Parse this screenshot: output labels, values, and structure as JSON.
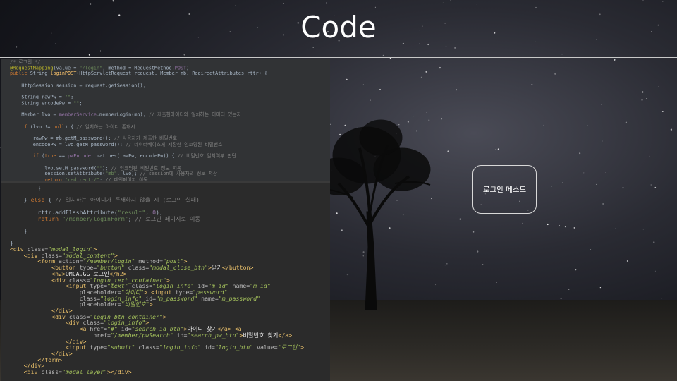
{
  "slide": {
    "title": "Code",
    "label_box": "로그인 메소드"
  },
  "code_top": [
    [
      [
        "cm",
        "/* 로그인 */"
      ]
    ],
    [
      [
        "ann",
        "@RequestMapping"
      ],
      [
        "txt",
        "(value = "
      ],
      [
        "str",
        "\"/login\""
      ],
      [
        "txt",
        ", method = RequestMethod."
      ],
      [
        "fld",
        "POST"
      ],
      [
        "txt",
        ")"
      ]
    ],
    [
      [
        "kw",
        "public "
      ],
      [
        "txt",
        "String "
      ],
      [
        "fn",
        "loginPOST"
      ],
      [
        "txt",
        "(HttpServletRequest request, Member mb, RedirectAttributes rttr) {"
      ]
    ],
    [
      [
        "txt",
        ""
      ]
    ],
    [
      [
        "txt",
        "    HttpSession session = request.getSession();"
      ]
    ],
    [
      [
        "txt",
        ""
      ]
    ],
    [
      [
        "txt",
        "    String "
      ],
      [
        "txt",
        "rawPw = "
      ],
      [
        "str",
        "\"\""
      ],
      [
        "txt",
        ";"
      ]
    ],
    [
      [
        "txt",
        "    String "
      ],
      [
        "txt",
        "encodePw = "
      ],
      [
        "str",
        "\"\""
      ],
      [
        "txt",
        ";"
      ]
    ],
    [
      [
        "txt",
        ""
      ]
    ],
    [
      [
        "txt",
        "    Member lvo = "
      ],
      [
        "fld",
        "memberService"
      ],
      [
        "txt",
        ".memberLogin(mb); "
      ],
      [
        "cm",
        "// 제출한아이디와 일치하는 아이디 있는지"
      ]
    ],
    [
      [
        "txt",
        ""
      ]
    ],
    [
      [
        "kw",
        "    if "
      ],
      [
        "txt",
        "(lvo != "
      ],
      [
        "kw",
        "null"
      ],
      [
        "txt",
        ") { "
      ],
      [
        "cm",
        "// 일치하는 아이디 존재시"
      ]
    ],
    [
      [
        "txt",
        ""
      ]
    ],
    [
      [
        "txt",
        "        rawPw = mb.getM_password(); "
      ],
      [
        "cm",
        "// 사용자가 제출한 비밀번호"
      ]
    ],
    [
      [
        "txt",
        "        encodePw = lvo.getM_password(); "
      ],
      [
        "cm",
        "// 데이터베이스에 저장한 인코딩된 비밀번호"
      ]
    ],
    [
      [
        "txt",
        ""
      ]
    ],
    [
      [
        "kw",
        "        if "
      ],
      [
        "txt",
        "("
      ],
      [
        "kw",
        "true "
      ],
      [
        "txt",
        "== "
      ],
      [
        "fld",
        "pwEncoder"
      ],
      [
        "txt",
        ".matches(rawPw, encodePw)) { "
      ],
      [
        "cm",
        "// 비밀번호 일치여부 판단"
      ]
    ],
    [
      [
        "txt",
        ""
      ]
    ],
    [
      [
        "txt",
        "            lvo.setM_password("
      ],
      [
        "str",
        "\"\""
      ],
      [
        "txt",
        "); "
      ],
      [
        "cm",
        "// 인코딩된 비밀번호 정보 지움"
      ]
    ],
    [
      [
        "txt",
        "            session.setAttribute("
      ],
      [
        "str",
        "\"mb\""
      ],
      [
        "txt",
        ", lvo); "
      ],
      [
        "cm",
        "// session에 사용자의 정보 저장"
      ]
    ],
    [
      [
        "kw",
        "            return "
      ],
      [
        "str",
        "\"redirect:/\""
      ],
      [
        "txt",
        "; "
      ],
      [
        "cm",
        "// 메인페이지 이동"
      ]
    ],
    [
      [
        "txt",
        "        } "
      ],
      [
        "kw",
        "else "
      ],
      [
        "txt",
        "{"
      ]
    ],
    [
      [
        "txt",
        "            rttr.addFlashAttribute("
      ],
      [
        "str",
        "\"result\""
      ],
      [
        "txt",
        ", "
      ],
      [
        "fld",
        "0"
      ],
      [
        "txt",
        ");"
      ]
    ],
    [
      [
        "kw",
        "            return "
      ],
      [
        "str",
        "\"/member/loginForm\""
      ],
      [
        "txt",
        "; "
      ],
      [
        "cm",
        "// 로그인 페이지로 이동"
      ]
    ]
  ],
  "code_bottom": [
    [
      [
        "txt",
        "        }"
      ]
    ],
    [
      [
        "txt",
        ""
      ]
    ],
    [
      [
        "txt",
        "    } "
      ],
      [
        "kw",
        "else "
      ],
      [
        "txt",
        "{ "
      ],
      [
        "cm",
        "// 일치하는 아이디가 존재하지 않을 시 (로그인 실패)"
      ]
    ],
    [
      [
        "txt",
        ""
      ]
    ],
    [
      [
        "txt",
        "        rttr.addFlashAttribute("
      ],
      [
        "str",
        "\"result\""
      ],
      [
        "txt",
        ", "
      ],
      [
        "fld",
        "0"
      ],
      [
        "txt",
        ");"
      ]
    ],
    [
      [
        "kw",
        "        return "
      ],
      [
        "str",
        "\"/member/loginForm\""
      ],
      [
        "txt",
        "; "
      ],
      [
        "cm",
        "// 로그인 페이지로 이동"
      ]
    ],
    [
      [
        "txt",
        ""
      ]
    ],
    [
      [
        "txt",
        "    }"
      ]
    ],
    [
      [
        "txt",
        ""
      ]
    ],
    [
      [
        "txt",
        "}"
      ]
    ],
    [
      [
        "tag",
        "<div "
      ],
      [
        "attr",
        "class="
      ],
      [
        "aval",
        "\"modal_login\""
      ],
      [
        "tag",
        ">"
      ]
    ],
    [
      [
        "tag",
        "    <div "
      ],
      [
        "attr",
        "class="
      ],
      [
        "aval",
        "\"modal_content\""
      ],
      [
        "tag",
        ">"
      ]
    ],
    [
      [
        "tag",
        "        <form "
      ],
      [
        "attr",
        "action="
      ],
      [
        "aval",
        "\"/member/login\" "
      ],
      [
        "attr",
        "method="
      ],
      [
        "aval",
        "\"post\""
      ],
      [
        "tag",
        ">"
      ]
    ],
    [
      [
        "tag",
        "            <button "
      ],
      [
        "attr",
        "type="
      ],
      [
        "aval",
        "\"button\" "
      ],
      [
        "attr",
        "class="
      ],
      [
        "aval",
        "\"modal_close_btn\""
      ],
      [
        "tag",
        ">"
      ],
      [
        "tag2",
        "닫기"
      ],
      [
        "tag",
        "</button>"
      ]
    ],
    [
      [
        "tag",
        "            <h2>"
      ],
      [
        "tag2",
        "OMCA.GG 로그인"
      ],
      [
        "tag",
        "</h2>"
      ]
    ],
    [
      [
        "tag",
        "            <div "
      ],
      [
        "attr",
        "class="
      ],
      [
        "aval",
        "\"login_text_container\""
      ],
      [
        "tag",
        ">"
      ]
    ],
    [
      [
        "tag",
        "                <input "
      ],
      [
        "attr",
        "type="
      ],
      [
        "aval",
        "\"text\" "
      ],
      [
        "attr",
        "class="
      ],
      [
        "aval",
        "\"login_info\" "
      ],
      [
        "attr",
        "id="
      ],
      [
        "aval",
        "\"m_id\" "
      ],
      [
        "attr",
        "name="
      ],
      [
        "aval",
        "\"m_id\""
      ]
    ],
    [
      [
        "attr",
        "                    placeholder="
      ],
      [
        "aval",
        "\"아이디\""
      ],
      [
        "tag",
        "> <input "
      ],
      [
        "attr",
        "type="
      ],
      [
        "aval",
        "\"password\""
      ]
    ],
    [
      [
        "attr",
        "                    class="
      ],
      [
        "aval",
        "\"login_info\" "
      ],
      [
        "attr",
        "id="
      ],
      [
        "aval",
        "\"m_password\" "
      ],
      [
        "attr",
        "name="
      ],
      [
        "aval",
        "\"m_password\""
      ]
    ],
    [
      [
        "attr",
        "                    placeholder="
      ],
      [
        "aval",
        "\"비밀번호\""
      ],
      [
        "tag",
        ">"
      ]
    ],
    [
      [
        "tag",
        "            </div>"
      ]
    ],
    [
      [
        "tag",
        "            <div "
      ],
      [
        "attr",
        "class="
      ],
      [
        "aval",
        "\"login_btn_container\""
      ],
      [
        "tag",
        ">"
      ]
    ],
    [
      [
        "tag",
        "                <div "
      ],
      [
        "attr",
        "class="
      ],
      [
        "aval",
        "\"login_info\""
      ],
      [
        "tag",
        ">"
      ]
    ],
    [
      [
        "tag",
        "                    <a "
      ],
      [
        "attr",
        "href="
      ],
      [
        "aval",
        "\"#\" "
      ],
      [
        "attr",
        "id="
      ],
      [
        "aval",
        "\"search_id_btn\""
      ],
      [
        "tag",
        ">"
      ],
      [
        "tag2",
        "아이디 찾기"
      ],
      [
        "tag",
        "</a> <a"
      ]
    ],
    [
      [
        "attr",
        "                        href="
      ],
      [
        "aval",
        "\"/member/pwSearch\" "
      ],
      [
        "attr",
        "id="
      ],
      [
        "aval",
        "\"search_pw_btn\""
      ],
      [
        "tag",
        ">"
      ],
      [
        "tag2",
        "비밀번호 찾기"
      ],
      [
        "tag",
        "</a>"
      ]
    ],
    [
      [
        "tag",
        "                </div>"
      ]
    ],
    [
      [
        "tag",
        "                <input "
      ],
      [
        "attr",
        "type="
      ],
      [
        "aval",
        "\"submit\" "
      ],
      [
        "attr",
        "class="
      ],
      [
        "aval",
        "\"login_info\" "
      ],
      [
        "attr",
        "id="
      ],
      [
        "aval",
        "\"login_btn\" "
      ],
      [
        "attr",
        "value="
      ],
      [
        "aval",
        "\"로그인\""
      ],
      [
        "tag",
        ">"
      ]
    ],
    [
      [
        "tag",
        "            </div>"
      ]
    ],
    [
      [
        "tag",
        "        </form>"
      ]
    ],
    [
      [
        "tag",
        "    </div>"
      ]
    ],
    [
      [
        "tag",
        "    <div "
      ],
      [
        "attr",
        "class="
      ],
      [
        "aval",
        "\"modal_layer\""
      ],
      [
        "tag",
        "></div>"
      ]
    ]
  ]
}
